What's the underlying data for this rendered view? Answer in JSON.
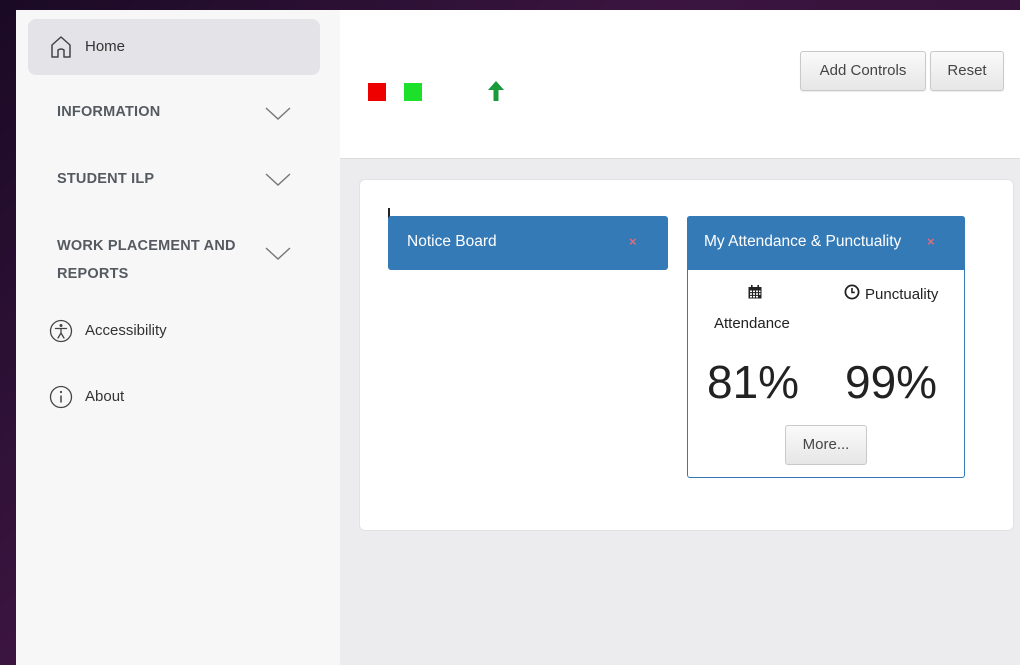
{
  "sidebar": {
    "home": {
      "label": "Home",
      "icon": "home-icon"
    },
    "sections": [
      {
        "label": "INFORMATION"
      },
      {
        "label": "STUDENT ILP"
      },
      {
        "label_line1": "WORK PLACEMENT AND",
        "label_line2": "REPORTS"
      }
    ],
    "accessibility": {
      "label": "Accessibility",
      "icon": "accessibility-icon"
    },
    "about": {
      "label": "About",
      "icon": "info-icon"
    }
  },
  "toolbar": {
    "indicators": [
      {
        "name": "red-indicator",
        "color": "#ee0000"
      },
      {
        "name": "green-indicator",
        "color": "#1de02a"
      }
    ],
    "arrow_color": "#1a9a3a",
    "add_controls_label": "Add Controls",
    "reset_label": "Reset"
  },
  "widgets": {
    "notice_board": {
      "title": "Notice Board",
      "close": "×"
    },
    "attendance": {
      "title": "My Attendance & Punctuality",
      "close": "×",
      "attendance_label": "Attendance",
      "punctuality_label": "Punctuality",
      "attendance_value": "81%",
      "punctuality_value": "99%",
      "more_label": "More..."
    }
  },
  "colors": {
    "header_blue": "#337ab7",
    "close_red": "#e06b7b"
  }
}
